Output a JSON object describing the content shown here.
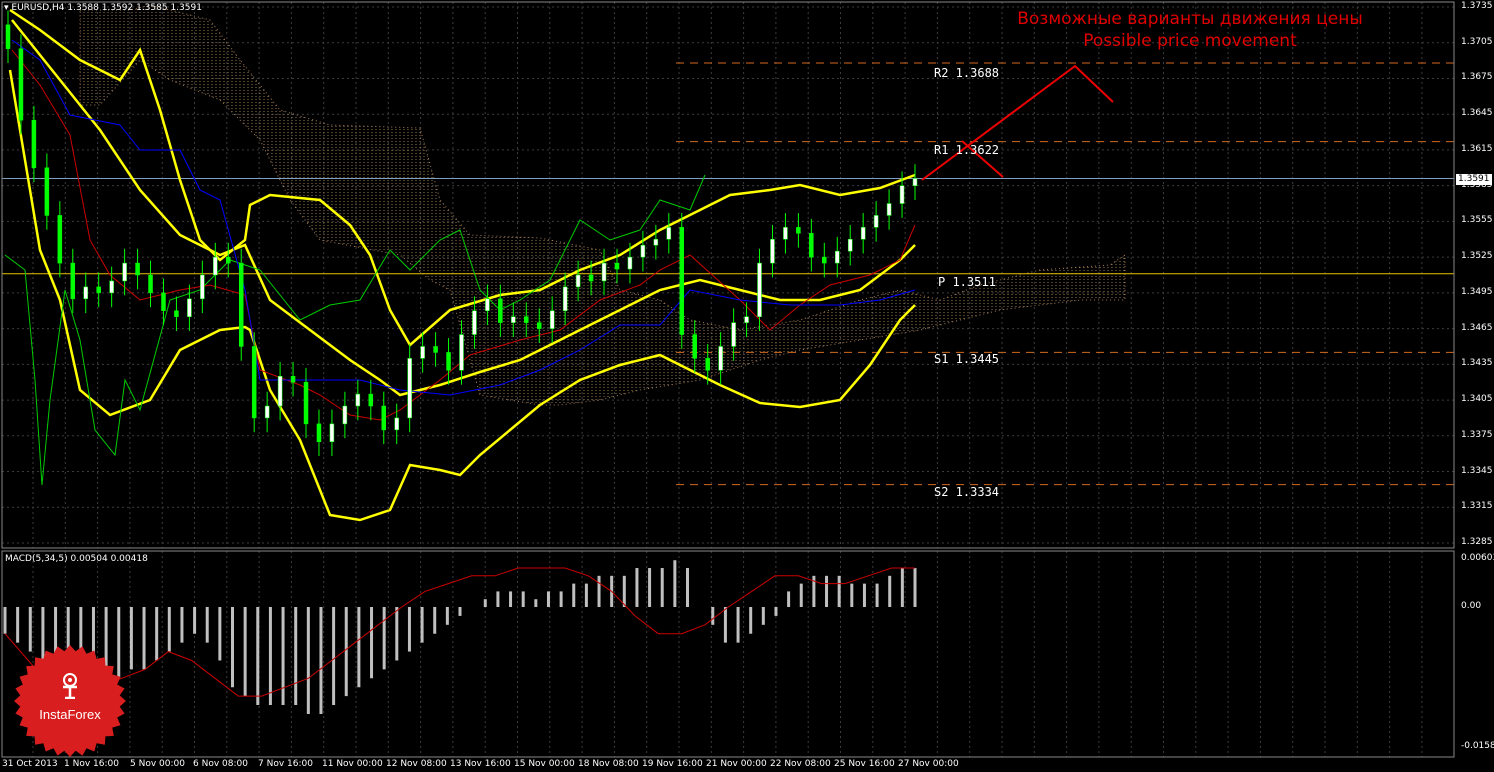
{
  "header": {
    "symbol": "EURUSD,H4",
    "ohlc": "1.3588 1.3592 1.3585 1.3591",
    "macd_label": "MACD(5,34,5)",
    "macd_values": "0.00504 0.00418"
  },
  "annotation": {
    "line1": "Возможные варианты движения цены",
    "line2": "Possible price movement"
  },
  "levels": [
    {
      "name": "R2",
      "value": "1.3688",
      "text": "R2  1.3688"
    },
    {
      "name": "R1",
      "value": "1.3622",
      "text": "R1  1.3622"
    },
    {
      "name": "P",
      "value": "1.3511",
      "text": "P  1.3511"
    },
    {
      "name": "S1",
      "value": "1.3445",
      "text": "S1  1.3445"
    },
    {
      "name": "S2",
      "value": "1.3334",
      "text": "S2  1.3334"
    }
  ],
  "current_price": "1.3591",
  "y_ticks": [
    "1.3735",
    "1.3705",
    "1.3675",
    "1.3645",
    "1.3615",
    "1.3585",
    "1.3555",
    "1.3525",
    "1.3495",
    "1.3465",
    "1.3435",
    "1.3405",
    "1.3375",
    "1.3345",
    "1.3315",
    "1.3285"
  ],
  "macd_ticks": [
    "0.00603",
    "0.00",
    "-0.01582"
  ],
  "x_ticks": [
    "31 Oct 2013",
    "1 Nov 16:00",
    "5 Nov 00:00",
    "6 Nov 08:00",
    "7 Nov 16:00",
    "11 Nov 00:00",
    "12 Nov 08:00",
    "13 Nov 16:00",
    "15 Nov 00:00",
    "18 Nov 08:00",
    "19 Nov 16:00",
    "21 Nov 00:00",
    "22 Nov 08:00",
    "25 Nov 16:00",
    "27 Nov 00:00"
  ],
  "logo": {
    "text": "InstaForex"
  },
  "colors": {
    "bollinger": "#ffff00",
    "bull_candle": "#ffffff",
    "bear_candle": "#00ff00",
    "green_line": "#00cc00",
    "red_line": "#cc0000",
    "blue_line": "#0000ff",
    "pivot": "#e8c000",
    "level": "#d2691e",
    "cloud": "#d2a070",
    "macd_hist": "#c0c0c0",
    "macd_signal": "#cc0000",
    "projection": "#ee0000",
    "logo": "#d81e1e"
  },
  "chart_data": {
    "type": "candlestick",
    "instrument": "EURUSD",
    "timeframe": "H4",
    "ylim": [
      1.3285,
      1.3735
    ],
    "close_series": [
      1.37,
      1.364,
      1.36,
      1.356,
      1.352,
      1.349,
      1.35,
      1.3495,
      1.3505,
      1.352,
      1.351,
      1.3495,
      1.348,
      1.3475,
      1.349,
      1.351,
      1.3525,
      1.352,
      1.345,
      1.339,
      1.34,
      1.3425,
      1.342,
      1.3385,
      1.337,
      1.3385,
      1.34,
      1.341,
      1.34,
      1.338,
      1.339,
      1.344,
      1.345,
      1.3445,
      1.343,
      1.346,
      1.348,
      1.349,
      1.347,
      1.3475,
      1.347,
      1.3465,
      1.348,
      1.35,
      1.351,
      1.3505,
      1.352,
      1.3515,
      1.3525,
      1.3535,
      1.354,
      1.355,
      1.346,
      1.344,
      1.343,
      1.345,
      1.347,
      1.3475,
      1.352,
      1.354,
      1.355,
      1.3545,
      1.3525,
      1.352,
      1.353,
      1.354,
      1.355,
      1.356,
      1.357,
      1.3585,
      1.3591
    ],
    "levels": {
      "R2": 1.3688,
      "R1": 1.3622,
      "P": 1.3511,
      "S1": 1.3445,
      "S2": 1.3334
    },
    "macd": {
      "ylim": [
        -0.01582,
        0.00603
      ],
      "histogram": [
        -0.003,
        -0.004,
        -0.005,
        -0.006,
        -0.007,
        -0.008,
        -0.009,
        -0.009,
        -0.008,
        -0.008,
        -0.007,
        -0.007,
        -0.006,
        -0.005,
        -0.004,
        -0.003,
        -0.004,
        -0.006,
        -0.009,
        -0.01,
        -0.011,
        -0.011,
        -0.011,
        -0.011,
        -0.012,
        -0.012,
        -0.011,
        -0.01,
        -0.009,
        -0.008,
        -0.007,
        -0.006,
        -0.005,
        -0.004,
        -0.003,
        -0.002,
        -0.001,
        0.0,
        0.001,
        0.002,
        0.002,
        0.002,
        0.001,
        0.002,
        0.002,
        0.003,
        0.003,
        0.004,
        0.004,
        0.004,
        0.005,
        0.005,
        0.005,
        0.006,
        0.005,
        0.0,
        -0.002,
        -0.004,
        -0.004,
        -0.003,
        -0.002,
        -0.001,
        0.002,
        0.003,
        0.004,
        0.004,
        0.004,
        0.003,
        0.003,
        0.003,
        0.004,
        0.005,
        0.005
      ],
      "signal": [
        -0.003,
        -0.006,
        -0.009,
        -0.01,
        -0.009,
        -0.008,
        -0.007,
        -0.005,
        -0.006,
        -0.008,
        -0.01,
        -0.01,
        -0.009,
        -0.008,
        -0.006,
        -0.004,
        -0.002,
        0.0,
        0.002,
        0.003,
        0.004,
        0.004,
        0.005,
        0.005,
        0.005,
        0.004,
        0.002,
        -0.001,
        -0.003,
        -0.003,
        -0.002,
        0.0,
        0.002,
        0.004,
        0.004,
        0.003,
        0.003,
        0.004,
        0.005,
        0.005
      ]
    },
    "projection": "up from 1.3591 to near R2 1.3688, then pullback"
  }
}
